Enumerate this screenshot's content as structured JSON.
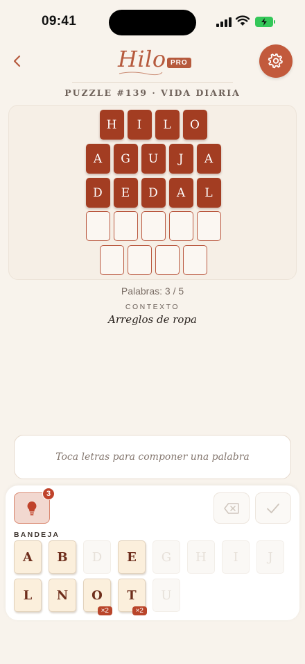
{
  "status": {
    "time": "09:41"
  },
  "header": {
    "brand": "Hilo",
    "badge": "PRO"
  },
  "puzzle": {
    "title": "PUZZLE #139 · VIDA DIARIA"
  },
  "board": {
    "rows": [
      {
        "letters": [
          "H",
          "I",
          "L",
          "O"
        ],
        "solved": true
      },
      {
        "letters": [
          "A",
          "G",
          "U",
          "J",
          "A"
        ],
        "solved": true
      },
      {
        "letters": [
          "D",
          "E",
          "D",
          "A",
          "L"
        ],
        "solved": true
      },
      {
        "letters": [
          "",
          "",
          "",
          "",
          ""
        ],
        "solved": false
      },
      {
        "letters": [
          "",
          "",
          "",
          ""
        ],
        "solved": false
      }
    ]
  },
  "progress": {
    "label": "Palabras: 3 / 5"
  },
  "context": {
    "label": "CONTEXTO",
    "value": "Arreglos de ropa"
  },
  "compose": {
    "placeholder": "Toca letras para componer una palabra"
  },
  "tray": {
    "hint_count": "3",
    "label": "BANDEJA",
    "tiles": [
      {
        "letter": "A",
        "state": "active",
        "count": ""
      },
      {
        "letter": "B",
        "state": "active",
        "count": ""
      },
      {
        "letter": "D",
        "state": "used",
        "count": ""
      },
      {
        "letter": "E",
        "state": "active",
        "count": ""
      },
      {
        "letter": "G",
        "state": "used",
        "count": ""
      },
      {
        "letter": "H",
        "state": "used",
        "count": ""
      },
      {
        "letter": "I",
        "state": "used",
        "count": ""
      },
      {
        "letter": "J",
        "state": "used",
        "count": ""
      },
      {
        "letter": "L",
        "state": "active",
        "count": ""
      },
      {
        "letter": "N",
        "state": "active",
        "count": ""
      },
      {
        "letter": "O",
        "state": "active",
        "count": "×2"
      },
      {
        "letter": "T",
        "state": "active",
        "count": "×2"
      },
      {
        "letter": "U",
        "state": "used",
        "count": ""
      }
    ]
  },
  "colors": {
    "accent": "#b65a3d",
    "tile_filled": "#a33d22",
    "background": "#f8f3ec"
  },
  "icons": {
    "back": "chevron-left-icon",
    "settings": "gear-icon",
    "hint": "lightbulb-icon",
    "delete": "backspace-icon",
    "submit": "checkmark-icon"
  }
}
